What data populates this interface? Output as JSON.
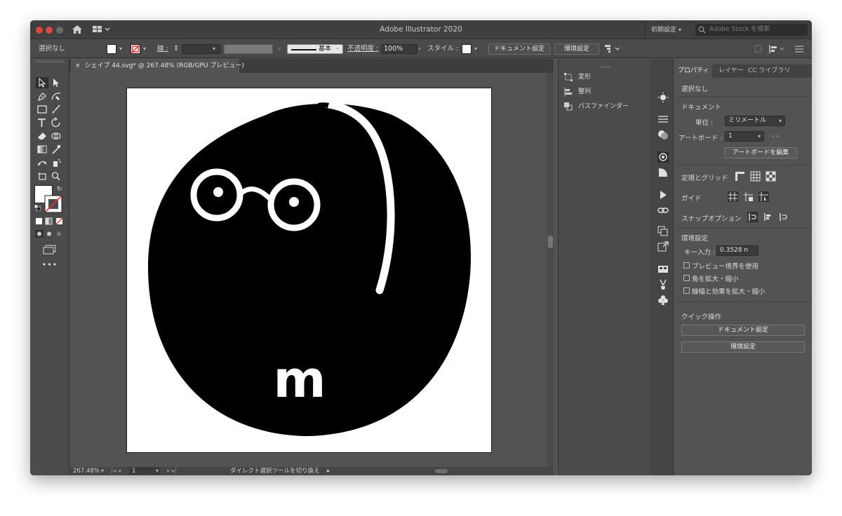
{
  "window": {
    "title": "Adobe Illustrator 2020"
  },
  "titlebar": {
    "workspace": "初期設定",
    "stock_placeholder": "Adobe Stock を検索"
  },
  "controlbar": {
    "selection": "選択なし",
    "stroke_label": "線 :",
    "stroke_style": "基本",
    "opacity_label": "不透明度 :",
    "opacity_value": "100%",
    "style_label": "スタイル :",
    "doc_settings": "ドキュメント設定",
    "prefs": "環境設定"
  },
  "document": {
    "tab_title": "シェイプ 44.svg* @ 267.48% (RGB/GPU プレビュー)",
    "close": "×"
  },
  "statusbar": {
    "zoom": "267.48%",
    "artboard_num": "1",
    "tool_hint": "ダイレクト選択ツールを切り換え"
  },
  "mid_panel": {
    "items": [
      "変形",
      "整列",
      "パスファインダー"
    ]
  },
  "properties": {
    "tabs": [
      "プロパティ",
      "レイヤー",
      "CC ライブラリ"
    ],
    "no_selection": "選択なし",
    "document_section": "ドキュメント",
    "units_label": "単位 :",
    "units_value": "ミリメートル",
    "artboard_label": "アートボード :",
    "artboard_value": "1",
    "edit_artboards": "アートボードを編集",
    "rulers_grids": "定規とグリッド",
    "guides": "ガイド",
    "snap_options": "スナップオプション",
    "prefs_section": "環境設定",
    "key_input_label": "キー入力 :",
    "key_input_value": "0.3528 n",
    "checkboxes": [
      "プレビュー境界を使用",
      "角を拡大・縮小",
      "線幅と効果を拡大・縮小"
    ],
    "quick_actions": "クイック操作",
    "qa_doc_settings": "ドキュメント設定",
    "qa_prefs": "環境設定"
  },
  "artwork": {
    "glyph": "m"
  },
  "colors": {
    "fill": "#ffffff",
    "canvas_bg": "#535353",
    "panel_bg": "#535353",
    "artwork": "#000000"
  }
}
